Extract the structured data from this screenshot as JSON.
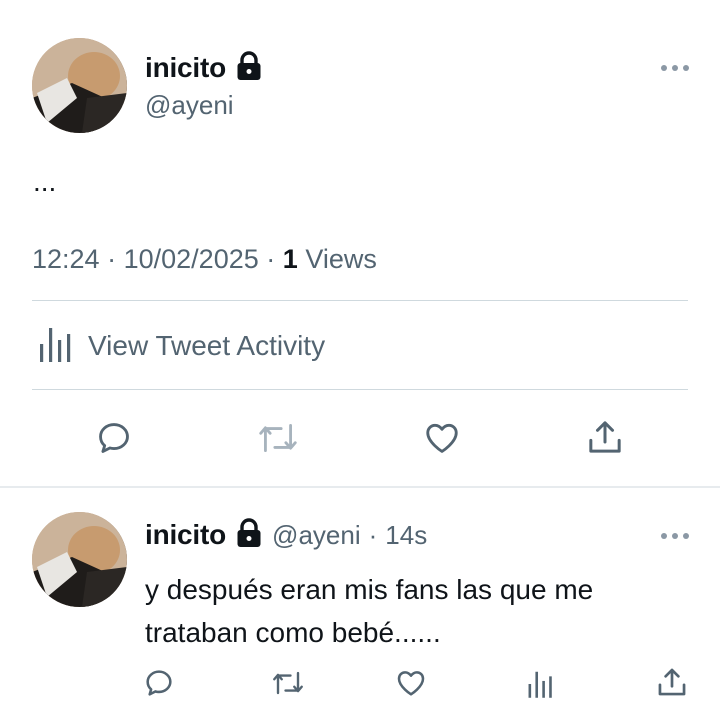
{
  "main_tweet": {
    "display_name": "inicito",
    "handle": "@ayeni",
    "text": "...",
    "time": "12:24",
    "date": "10/02/2025",
    "separator": "·",
    "view_count": "1",
    "views_label": "Views",
    "activity_label": "View Tweet Activity"
  },
  "reply": {
    "display_name": "inicito",
    "handle": "@ayeni",
    "separator": "·",
    "time_ago": "14s",
    "text_line1": "y después eran mis fans las que me",
    "text_line2": "trataban como bebé......"
  },
  "icons": {
    "lock": "lock-icon",
    "more": "more-icon",
    "reply": "reply-icon",
    "retweet": "retweet-icon",
    "like": "heart-icon",
    "share": "share-icon",
    "analytics": "analytics-icon"
  },
  "colors": {
    "text": "#0f1419",
    "secondary": "#536471",
    "divider": "#cfd9de"
  }
}
